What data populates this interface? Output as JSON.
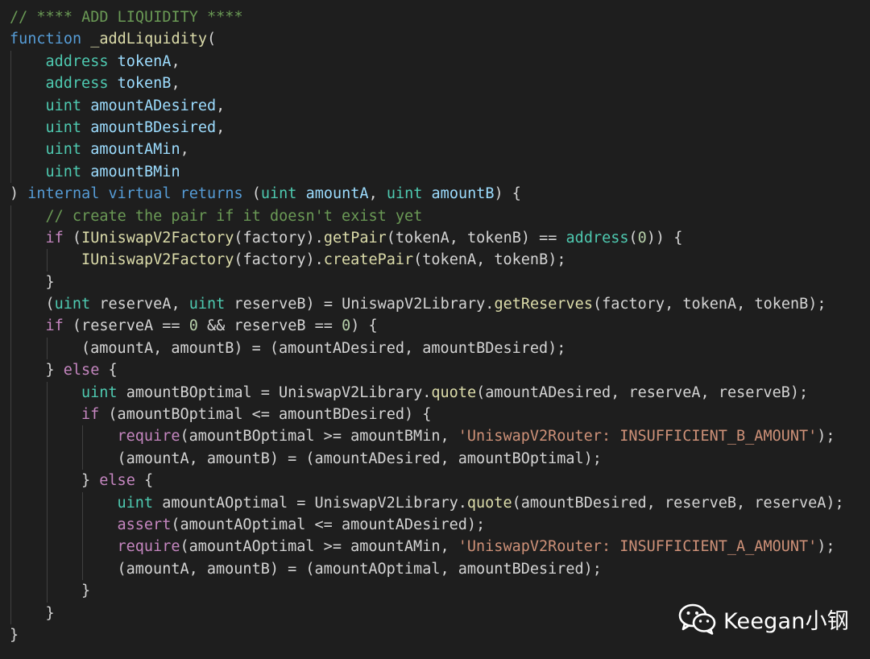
{
  "editor": {
    "theme_colors": {
      "background": "#1e1e1e",
      "comment": "#6a9955",
      "keyword": "#569cd6",
      "type": "#4ec9b0",
      "param": "#9cdcfe",
      "function": "#dcdcaa",
      "control": "#c586c0",
      "string": "#ce9178",
      "number": "#b5cea8",
      "plain": "#d4d4d4"
    },
    "lines": [
      {
        "indent": 0,
        "tokens": [
          [
            "comment",
            "// **** ADD LIQUIDITY ****"
          ]
        ]
      },
      {
        "indent": 0,
        "tokens": [
          [
            "keyword",
            "function"
          ],
          [
            "plain",
            " "
          ],
          [
            "func",
            "_addLiquidity"
          ],
          [
            "plain",
            "("
          ]
        ]
      },
      {
        "indent": 1,
        "tokens": [
          [
            "type",
            "address"
          ],
          [
            "plain",
            " "
          ],
          [
            "param",
            "tokenA"
          ],
          [
            "plain",
            ","
          ]
        ]
      },
      {
        "indent": 1,
        "tokens": [
          [
            "type",
            "address"
          ],
          [
            "plain",
            " "
          ],
          [
            "param",
            "tokenB"
          ],
          [
            "plain",
            ","
          ]
        ]
      },
      {
        "indent": 1,
        "tokens": [
          [
            "type",
            "uint"
          ],
          [
            "plain",
            " "
          ],
          [
            "param",
            "amountADesired"
          ],
          [
            "plain",
            ","
          ]
        ]
      },
      {
        "indent": 1,
        "tokens": [
          [
            "type",
            "uint"
          ],
          [
            "plain",
            " "
          ],
          [
            "param",
            "amountBDesired"
          ],
          [
            "plain",
            ","
          ]
        ]
      },
      {
        "indent": 1,
        "tokens": [
          [
            "type",
            "uint"
          ],
          [
            "plain",
            " "
          ],
          [
            "param",
            "amountAMin"
          ],
          [
            "plain",
            ","
          ]
        ]
      },
      {
        "indent": 1,
        "tokens": [
          [
            "type",
            "uint"
          ],
          [
            "plain",
            " "
          ],
          [
            "param",
            "amountBMin"
          ]
        ]
      },
      {
        "indent": 0,
        "tokens": [
          [
            "plain",
            ") "
          ],
          [
            "keyword",
            "internal"
          ],
          [
            "plain",
            " "
          ],
          [
            "keyword",
            "virtual"
          ],
          [
            "plain",
            " "
          ],
          [
            "keyword",
            "returns"
          ],
          [
            "plain",
            " ("
          ],
          [
            "type",
            "uint"
          ],
          [
            "plain",
            " "
          ],
          [
            "param",
            "amountA"
          ],
          [
            "plain",
            ", "
          ],
          [
            "type",
            "uint"
          ],
          [
            "plain",
            " "
          ],
          [
            "param",
            "amountB"
          ],
          [
            "plain",
            ") {"
          ]
        ]
      },
      {
        "indent": 1,
        "tokens": [
          [
            "comment",
            "// create the pair if it doesn't exist yet"
          ]
        ]
      },
      {
        "indent": 1,
        "tokens": [
          [
            "control",
            "if"
          ],
          [
            "plain",
            " ("
          ],
          [
            "func",
            "IUniswapV2Factory"
          ],
          [
            "plain",
            "(factory)."
          ],
          [
            "func",
            "getPair"
          ],
          [
            "plain",
            "(tokenA, tokenB) == "
          ],
          [
            "type",
            "address"
          ],
          [
            "plain",
            "("
          ],
          [
            "number",
            "0"
          ],
          [
            "plain",
            ")) {"
          ]
        ]
      },
      {
        "indent": 2,
        "tokens": [
          [
            "func",
            "IUniswapV2Factory"
          ],
          [
            "plain",
            "(factory)."
          ],
          [
            "func",
            "createPair"
          ],
          [
            "plain",
            "(tokenA, tokenB);"
          ]
        ]
      },
      {
        "indent": 1,
        "tokens": [
          [
            "plain",
            "}"
          ]
        ]
      },
      {
        "indent": 1,
        "tokens": [
          [
            "plain",
            "("
          ],
          [
            "type",
            "uint"
          ],
          [
            "plain",
            " reserveA, "
          ],
          [
            "type",
            "uint"
          ],
          [
            "plain",
            " reserveB) = UniswapV2Library."
          ],
          [
            "func",
            "getReserves"
          ],
          [
            "plain",
            "(factory, tokenA, tokenB);"
          ]
        ]
      },
      {
        "indent": 1,
        "tokens": [
          [
            "control",
            "if"
          ],
          [
            "plain",
            " (reserveA == "
          ],
          [
            "number",
            "0"
          ],
          [
            "plain",
            " && reserveB == "
          ],
          [
            "number",
            "0"
          ],
          [
            "plain",
            ") {"
          ]
        ]
      },
      {
        "indent": 2,
        "tokens": [
          [
            "plain",
            "(amountA, amountB) = (amountADesired, amountBDesired);"
          ]
        ]
      },
      {
        "indent": 1,
        "tokens": [
          [
            "plain",
            "} "
          ],
          [
            "control",
            "else"
          ],
          [
            "plain",
            " {"
          ]
        ]
      },
      {
        "indent": 2,
        "tokens": [
          [
            "type",
            "uint"
          ],
          [
            "plain",
            " amountBOptimal = UniswapV2Library."
          ],
          [
            "func",
            "quote"
          ],
          [
            "plain",
            "(amountADesired, reserveA, reserveB);"
          ]
        ]
      },
      {
        "indent": 2,
        "tokens": [
          [
            "control",
            "if"
          ],
          [
            "plain",
            " (amountBOptimal <= amountBDesired) {"
          ]
        ]
      },
      {
        "indent": 3,
        "tokens": [
          [
            "control",
            "require"
          ],
          [
            "plain",
            "(amountBOptimal >= amountBMin, "
          ],
          [
            "string",
            "'UniswapV2Router: INSUFFICIENT_B_AMOUNT'"
          ],
          [
            "plain",
            ");"
          ]
        ]
      },
      {
        "indent": 3,
        "tokens": [
          [
            "plain",
            "(amountA, amountB) = (amountADesired, amountBOptimal);"
          ]
        ]
      },
      {
        "indent": 2,
        "tokens": [
          [
            "plain",
            "} "
          ],
          [
            "control",
            "else"
          ],
          [
            "plain",
            " {"
          ]
        ]
      },
      {
        "indent": 3,
        "tokens": [
          [
            "type",
            "uint"
          ],
          [
            "plain",
            " amountAOptimal = UniswapV2Library."
          ],
          [
            "func",
            "quote"
          ],
          [
            "plain",
            "(amountBDesired, reserveB, reserveA);"
          ]
        ]
      },
      {
        "indent": 3,
        "tokens": [
          [
            "control",
            "assert"
          ],
          [
            "plain",
            "(amountAOptimal <= amountADesired);"
          ]
        ]
      },
      {
        "indent": 3,
        "tokens": [
          [
            "control",
            "require"
          ],
          [
            "plain",
            "(amountAOptimal >= amountAMin, "
          ],
          [
            "string",
            "'UniswapV2Router: INSUFFICIENT_A_AMOUNT'"
          ],
          [
            "plain",
            ");"
          ]
        ]
      },
      {
        "indent": 3,
        "tokens": [
          [
            "plain",
            "(amountA, amountB) = (amountAOptimal, amountBDesired);"
          ]
        ]
      },
      {
        "indent": 2,
        "tokens": [
          [
            "plain",
            "}"
          ]
        ]
      },
      {
        "indent": 1,
        "tokens": [
          [
            "plain",
            "}"
          ]
        ]
      },
      {
        "indent": 0,
        "tokens": [
          [
            "plain",
            "}"
          ]
        ]
      }
    ]
  },
  "watermark": {
    "icon": "wechat-icon",
    "text": "Keegan小钢"
  }
}
